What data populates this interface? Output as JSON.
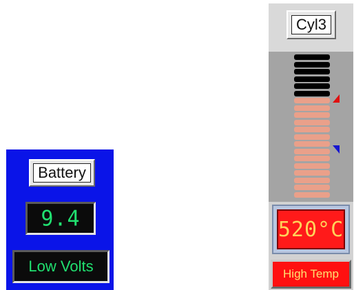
{
  "battery": {
    "label": "Battery",
    "value": "9.4",
    "status": "Low Volts"
  },
  "cylinder": {
    "label": "Cyl3",
    "temperature": "520°C",
    "status": "High Temp",
    "bar_count_dark": 6,
    "bar_count_lit": 14,
    "level_fraction": 0.7
  },
  "colors": {
    "battery_panel": "#0a14e8",
    "segment_green": "#20e070",
    "bar_dark": "#000000",
    "bar_lit": "#eaa08a",
    "alarm_red": "#ff1010",
    "high_marker": "#e01010",
    "low_marker": "#1616d0"
  },
  "icons": {
    "high_marker": "triangle-high-setpoint-icon",
    "low_marker": "triangle-low-setpoint-icon"
  }
}
